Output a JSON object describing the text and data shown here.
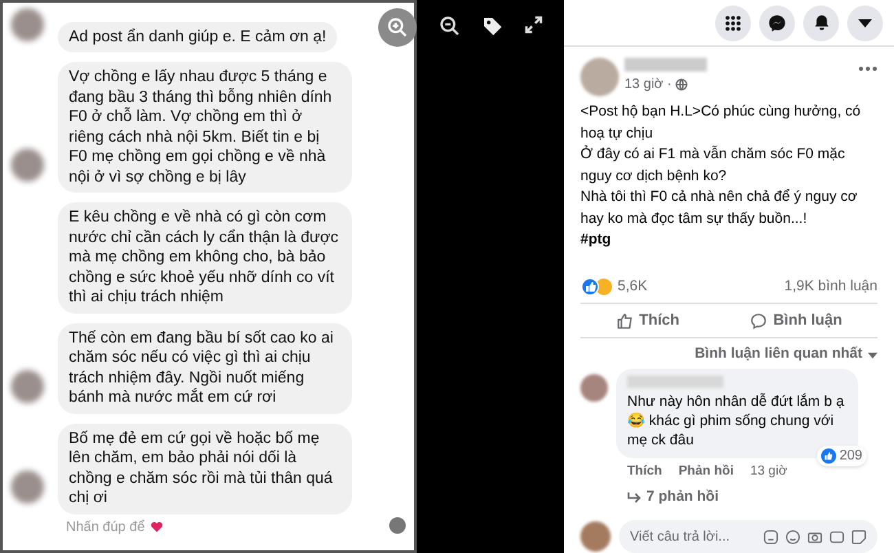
{
  "chat_image": {
    "messages": [
      {
        "text": "Ad post ẩn danh giúp e. E cảm ơn ạ!",
        "avatar": true
      },
      {
        "text": "Vợ chồng e lấy nhau được 5 tháng e đang bầu 3 tháng thì bỗng nhiên dính F0 ở chỗ làm. Vợ chồng em thì ở riêng cách nhà nội 5km. Biết tin e bị F0 mẹ chồng em gọi chồng e về nhà nội ở vì sợ chồng e bị lây",
        "avatar": true
      },
      {
        "text": "E kêu chồng e về nhà có gì còn cơm nước chỉ cần cách ly cẩn thận là được mà mẹ chồng em không cho, bà bảo chồng e sức khoẻ yếu nhỡ dính co vít thì ai chịu trách nhiệm",
        "avatar": false
      },
      {
        "text": "Thế còn em đang bầu bí sốt cao ko ai chăm sóc nếu có việc gì thì ai chịu trách nhiệm đây. Ngồi nuốt miếng bánh mà nước mắt em cứ rơi",
        "avatar": true
      },
      {
        "text": "Bố mẹ đẻ em cứ gọi về hoặc bố mẹ lên chăm, em bảo phải nói dối là chồng e chăm sóc rồi mà tủi thân quá chị ơi",
        "avatar": true
      }
    ],
    "footer": "Nhấn đúp để"
  },
  "post": {
    "time": "13 giờ ·",
    "paragraphs": [
      "<Post hộ bạn H.L>Có phúc cùng hưởng, có hoạ tự chịu",
      "Ở đây có ai F1 mà vẫn chăm sóc F0 mặc nguy cơ dịch bệnh ko?",
      "Nhà tôi thì F0 cả nhà nên chả để ý nguy cơ hay ko mà đọc tâm sự thấy buồn...!"
    ],
    "hashtag": "#ptg",
    "reactions": "5,6K",
    "comments_count": "1,9K bình luận",
    "actions": [
      "Thích",
      "Bình luận"
    ],
    "sort": "Bình luận liên quan nhất"
  },
  "comment": {
    "text": "Như này hôn nhân dễ đứt lắm b ạ 😂 khác gì phim sống chung với mẹ ck đâu",
    "likes": "209",
    "actions": [
      "Thích",
      "Phản hồi",
      "13 giờ"
    ],
    "replies": "7 phản hồi"
  },
  "reply_box": {
    "placeholder": "Viết câu trả lời..."
  }
}
